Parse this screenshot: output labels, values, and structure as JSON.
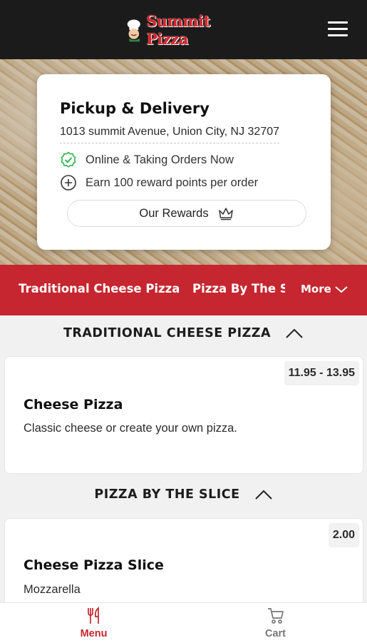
{
  "header": {
    "logo_text": "Summit Pizza",
    "menu_icon": "hamburger-icon"
  },
  "location": {
    "title": "Pickup & Delivery",
    "address": "1013 summit Avenue, Union City, NJ 32707",
    "status_text": "Online & Taking Orders Now",
    "rewards_text": "Earn 100 reward points per order",
    "rewards_button": "Our Rewards"
  },
  "categories": {
    "items": [
      "Traditional Cheese Pizza",
      "Pizza By The Slice"
    ],
    "more_label": "More"
  },
  "sections": [
    {
      "title": "TRADITIONAL CHEESE PIZZA",
      "items": [
        {
          "name": "Cheese Pizza",
          "description": "Classic cheese or create your own pizza.",
          "price": "11.95 - 13.95"
        }
      ]
    },
    {
      "title": "PIZZA BY THE SLICE",
      "items": [
        {
          "name": "Cheese Pizza Slice",
          "description": "Mozzarella",
          "price": "2.00"
        }
      ]
    }
  ],
  "bottom_nav": {
    "menu_label": "Menu",
    "cart_label": "Cart"
  },
  "colors": {
    "brand_red": "#c5262f",
    "header_bg": "#1b1b1b",
    "status_green": "#2fb34a"
  }
}
